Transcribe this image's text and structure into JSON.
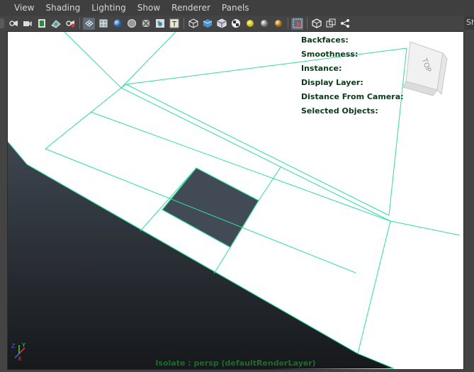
{
  "menu": [
    "View",
    "Shading",
    "Lighting",
    "Show",
    "Renderer",
    "Panels"
  ],
  "right_tab_label": "Sh",
  "toolbar": {
    "groups": [
      [
        "camera-attributes-icon",
        "bookmark-camera-icon",
        "film-gate-icon",
        "image-plane-icon",
        "grease-pencil-icon"
      ],
      [
        "wireframe-icon",
        "wireframe-on-shaded-icon",
        "smooth-shade-icon",
        "flat-shade-icon",
        "bounding-box-icon",
        "textured-icon",
        "text-label-icon"
      ],
      [
        "isolate-select-icon",
        "default-material-icon",
        "xray-icon",
        "checker-icon",
        "use-all-lights-icon",
        "sphere-gray-icon",
        "sphere-gold-icon"
      ],
      [
        "camera-gate-icon"
      ],
      [
        "isolate-view-icon",
        "two-panel-icon",
        "node-editor-icon"
      ]
    ]
  },
  "hud": {
    "lines": [
      "Backfaces:",
      "Smoothness:",
      "Instance:",
      "Display Layer:",
      "Distance From Camera:",
      "Selected Objects:"
    ]
  },
  "view_cube": {
    "label": "TOP"
  },
  "isolate_text": "Isolate : persp (defaultRenderLayer)",
  "axis": {
    "x": "X",
    "y": "Y",
    "z": "Z"
  },
  "colors": {
    "wire": "#2fdca0",
    "selected_face": "#414a55",
    "ground_top": "#3e4650",
    "ground_bottom": "#16181b"
  }
}
